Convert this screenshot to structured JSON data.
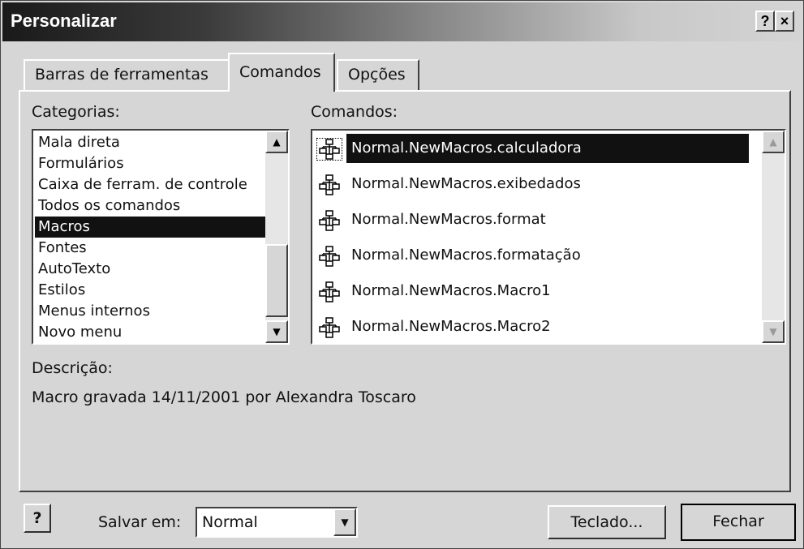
{
  "window": {
    "title": "Personalizar",
    "help_button": "?",
    "close_button": "×"
  },
  "tabs": [
    {
      "label": "Barras de ferramentas",
      "active": false
    },
    {
      "label": "Comandos",
      "active": true
    },
    {
      "label": "Opções",
      "active": false
    }
  ],
  "categorias": {
    "label": "Categorias:",
    "items": [
      "Mala direta",
      "Formulários",
      "Caixa de ferram. de controle",
      "Todos os comandos",
      "Macros",
      "Fontes",
      "AutoTexto",
      "Estilos",
      "Menus internos",
      "Novo menu"
    ],
    "selected": "Macros"
  },
  "comandos": {
    "label": "Comandos:",
    "items": [
      "Normal.NewMacros.calculadora",
      "Normal.NewMacros.exibedados",
      "Normal.NewMacros.format",
      "Normal.NewMacros.formatação",
      "Normal.NewMacros.Macro1",
      "Normal.NewMacros.Macro2"
    ],
    "selected": "Normal.NewMacros.calculadora",
    "icon": "macro-tree-icon"
  },
  "descricao": {
    "label": "Descrição:",
    "text": "Macro gravada 14/11/2001 por Alexandra Toscaro"
  },
  "footer": {
    "help_label": "?",
    "salvar_label": "Salvar em:",
    "salvar_value": "Normal",
    "teclado_label": "Teclado...",
    "fechar_label": "Fechar"
  }
}
